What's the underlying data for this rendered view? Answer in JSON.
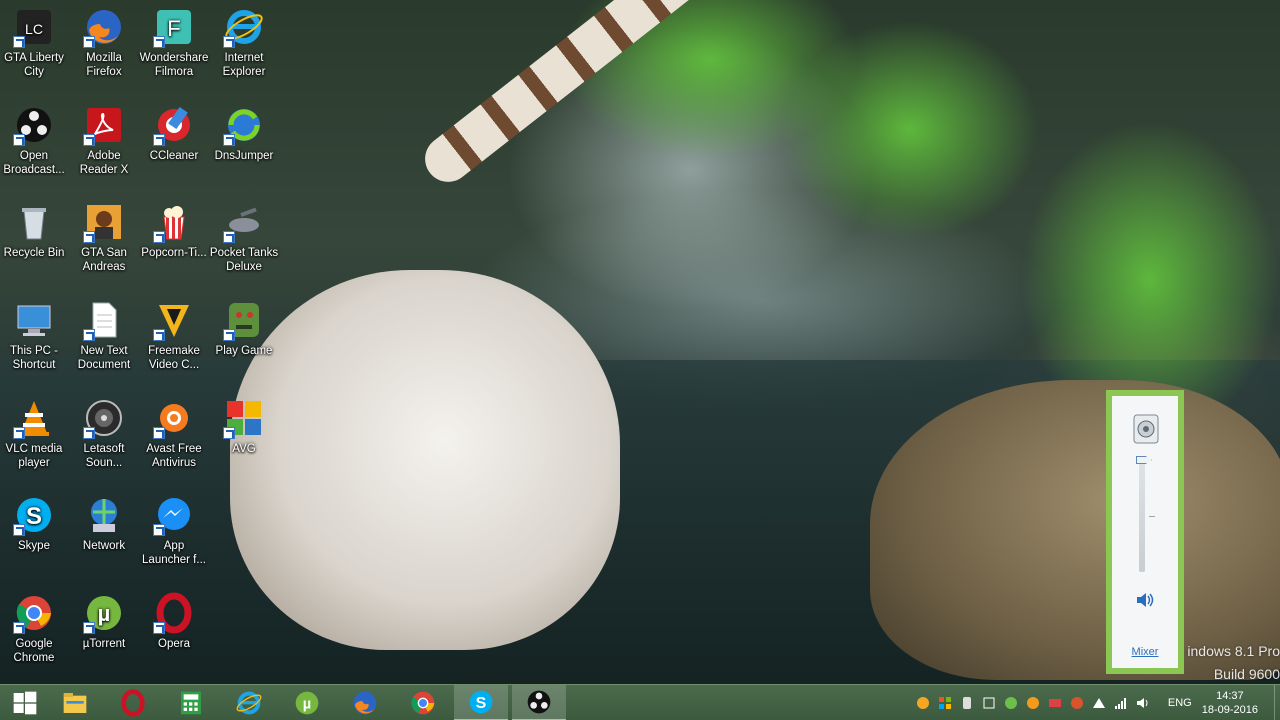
{
  "desktop": {
    "icons": [
      {
        "label": "GTA Liberty\nCity",
        "icon": "gta-liberty-city-icon"
      },
      {
        "label": "Mozilla\nFirefox",
        "icon": "firefox-icon"
      },
      {
        "label": "Wondershare\nFilmora",
        "icon": "filmora-icon"
      },
      {
        "label": "Internet\nExplorer",
        "icon": "internet-explorer-icon"
      },
      {
        "label": "Open\nBroadcast...",
        "icon": "obs-icon"
      },
      {
        "label": "Adobe\nReader X",
        "icon": "adobe-reader-icon"
      },
      {
        "label": "CCleaner",
        "icon": "ccleaner-icon"
      },
      {
        "label": "DnsJumper",
        "icon": "dnsjumper-icon"
      },
      {
        "label": "Recycle Bin",
        "icon": "recycle-bin-icon"
      },
      {
        "label": "GTA San\nAndreas",
        "icon": "gta-san-andreas-icon"
      },
      {
        "label": "Popcorn-Ti...",
        "icon": "popcorn-time-icon"
      },
      {
        "label": "Pocket Tanks\nDeluxe",
        "icon": "pocket-tanks-icon"
      },
      {
        "label": "This PC -\nShortcut",
        "icon": "this-pc-icon"
      },
      {
        "label": "New Text\nDocument",
        "icon": "text-document-icon"
      },
      {
        "label": "Freemake\nVideo C...",
        "icon": "freemake-icon"
      },
      {
        "label": "Play Game",
        "icon": "play-game-icon"
      },
      {
        "label": "VLC media\nplayer",
        "icon": "vlc-icon"
      },
      {
        "label": "Letasoft\nSoun...",
        "icon": "letasoft-sound-icon"
      },
      {
        "label": "Avast Free\nAntivirus",
        "icon": "avast-icon"
      },
      {
        "label": "AVG",
        "icon": "avg-icon"
      },
      {
        "label": "Skype",
        "icon": "skype-icon"
      },
      {
        "label": "Network",
        "icon": "network-icon"
      },
      {
        "label": "App\nLauncher f...",
        "icon": "messenger-icon"
      },
      {
        "label": "",
        "icon": ""
      },
      {
        "label": "Google\nChrome",
        "icon": "chrome-icon"
      },
      {
        "label": "µTorrent",
        "icon": "utorrent-icon"
      },
      {
        "label": "Opera",
        "icon": "opera-icon"
      }
    ]
  },
  "volume_flyout": {
    "mixer_label": "Mixer",
    "level_percent": 100,
    "device_icon": "speaker-device-icon",
    "mute_icon": "speaker-volume-icon"
  },
  "watermark": {
    "line1": "indows 8.1 Pro",
    "line2": "Build 9600"
  },
  "taskbar": {
    "buttons": [
      {
        "icon": "windows-start-icon"
      },
      {
        "icon": "file-explorer-icon"
      },
      {
        "icon": "opera-icon"
      },
      {
        "icon": "calculator-icon"
      },
      {
        "icon": "internet-explorer-icon"
      },
      {
        "icon": "utorrent-icon"
      },
      {
        "icon": "firefox-icon"
      },
      {
        "icon": "chrome-icon"
      },
      {
        "icon": "skype-icon"
      },
      {
        "icon": "obs-icon"
      }
    ],
    "tray": {
      "language": "ENG",
      "time": "14:37",
      "date": "18-09-2016"
    }
  },
  "colors": {
    "taskbar": "#3f5d41",
    "flyout_border": "#8cc653",
    "link": "#2a6fbd"
  }
}
